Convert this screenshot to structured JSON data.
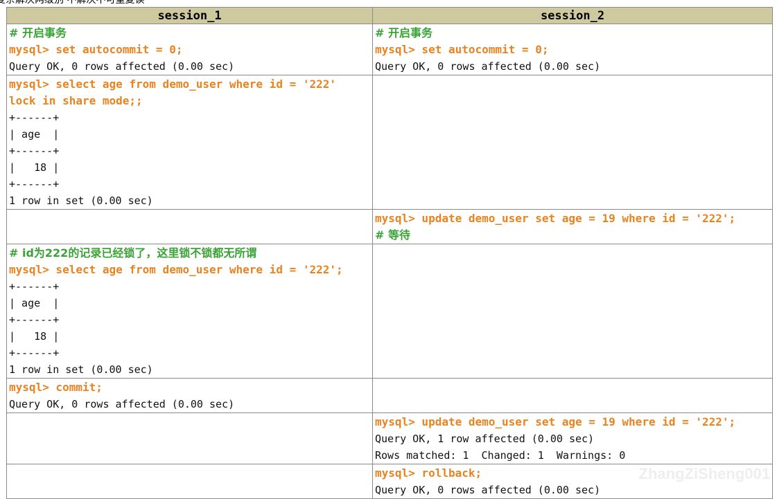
{
  "caption": "复杂解决两级别 不解决不可重复读",
  "colors": {
    "header_bg": "#cfc9a0",
    "comment": "#3aa335",
    "command": "#e8831f",
    "output": "#111111",
    "grid": "#8a8a8a"
  },
  "headers": [
    "session_1",
    "session_2"
  ],
  "rows": [
    {
      "left": [
        {
          "type": "comment",
          "text": "# 开启事务"
        },
        {
          "type": "command",
          "text": "mysql> set autocommit = 0;"
        },
        {
          "type": "output",
          "text": "Query OK, 0 rows affected (0.00 sec)"
        }
      ],
      "right": [
        {
          "type": "comment",
          "text": "# 开启事务"
        },
        {
          "type": "command",
          "text": "mysql> set autocommit = 0;"
        },
        {
          "type": "output",
          "text": "Query OK, 0 rows affected (0.00 sec)"
        }
      ]
    },
    {
      "left": [
        {
          "type": "command",
          "text": "mysql> select age from demo_user where id = '222'"
        },
        {
          "type": "command",
          "text": "lock in share mode;;"
        },
        {
          "type": "output",
          "text": "+------+"
        },
        {
          "type": "output",
          "text": "| age  |"
        },
        {
          "type": "output",
          "text": "+------+"
        },
        {
          "type": "output",
          "text": "|   18 |"
        },
        {
          "type": "output",
          "text": "+------+"
        },
        {
          "type": "output",
          "text": "1 row in set (0.00 sec)"
        }
      ],
      "right": []
    },
    {
      "left": [],
      "right": [
        {
          "type": "command",
          "text": "mysql> update demo_user set age = 19 where id = '222';"
        },
        {
          "type": "comment",
          "text": "# 等待"
        }
      ]
    },
    {
      "left": [
        {
          "type": "comment",
          "text": "# id为222的记录已经锁了，这里锁不锁都无所谓"
        },
        {
          "type": "command",
          "text": "mysql> select age from demo_user where id = '222';"
        },
        {
          "type": "output",
          "text": "+------+"
        },
        {
          "type": "output",
          "text": "| age  |"
        },
        {
          "type": "output",
          "text": "+------+"
        },
        {
          "type": "output",
          "text": "|   18 |"
        },
        {
          "type": "output",
          "text": "+------+"
        },
        {
          "type": "output",
          "text": "1 row in set (0.00 sec)"
        }
      ],
      "right": []
    },
    {
      "left": [
        {
          "type": "command",
          "text": "mysql> commit;"
        },
        {
          "type": "output",
          "text": "Query OK, 0 rows affected (0.00 sec)"
        }
      ],
      "right": []
    },
    {
      "left": [],
      "right": [
        {
          "type": "command",
          "text": "mysql> update demo_user set age = 19 where id = '222';"
        },
        {
          "type": "output",
          "text": "Query OK, 1 row affected (0.00 sec)"
        },
        {
          "type": "output",
          "text": "Rows matched: 1  Changed: 1  Warnings: 0"
        }
      ]
    },
    {
      "left": [],
      "right": [
        {
          "type": "command",
          "text": "mysql> rollback;"
        },
        {
          "type": "output",
          "text": "Query OK, 0 rows affected (0.00 sec)"
        }
      ]
    }
  ],
  "watermark": "ZhangZiSheng001"
}
